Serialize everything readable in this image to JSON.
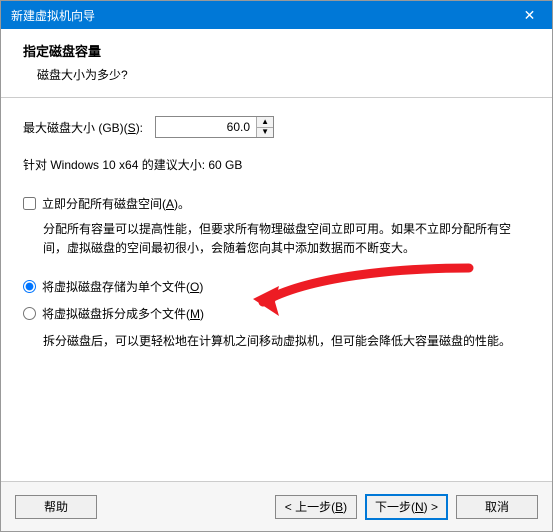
{
  "titlebar": {
    "text": "新建虚拟机向导"
  },
  "header": {
    "title": "指定磁盘容量",
    "subtitle": "磁盘大小为多少?"
  },
  "size": {
    "label_pre": "最大磁盘大小 (GB)(",
    "label_key": "S",
    "label_post": "):",
    "value": "60.0"
  },
  "recommend": {
    "text": "针对 Windows 10 x64 的建议大小: 60 GB"
  },
  "allocate": {
    "label_pre": "立即分配所有磁盘空间(",
    "label_key": "A",
    "label_post": ")。",
    "desc": "分配所有容量可以提高性能，但要求所有物理磁盘空间立即可用。如果不立即分配所有空间，虚拟磁盘的空间最初很小，会随着您向其中添加数据而不断变大。"
  },
  "radio_single": {
    "label_pre": "将虚拟磁盘存储为单个文件(",
    "label_key": "O",
    "label_post": ")"
  },
  "radio_split": {
    "label_pre": "将虚拟磁盘拆分成多个文件(",
    "label_key": "M",
    "label_post": ")",
    "desc": "拆分磁盘后，可以更轻松地在计算机之间移动虚拟机，但可能会降低大容量磁盘的性能。"
  },
  "footer": {
    "help": "帮助",
    "back_pre": "< 上一步(",
    "back_key": "B",
    "back_post": ")",
    "next_pre": "下一步(",
    "next_key": "N",
    "next_post": ") >",
    "cancel": "取消"
  }
}
